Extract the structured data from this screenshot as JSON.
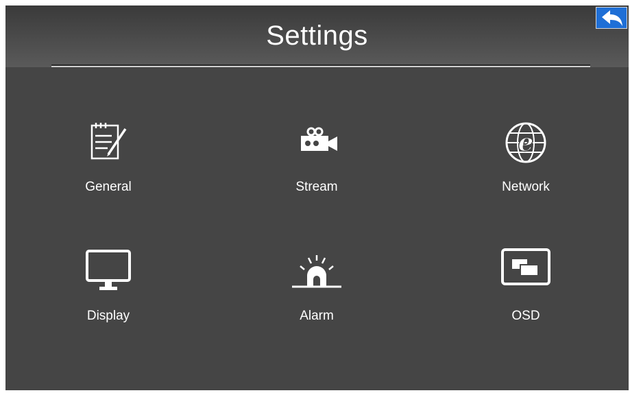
{
  "header": {
    "title": "Settings"
  },
  "back_button": {
    "icon": "back-arrow-icon",
    "color": "#1f6fd6"
  },
  "menu": [
    {
      "label": "General",
      "icon": "notepad-pencil-icon"
    },
    {
      "label": "Stream",
      "icon": "video-camera-icon"
    },
    {
      "label": "Network",
      "icon": "globe-e-icon"
    },
    {
      "label": "Display",
      "icon": "monitor-icon"
    },
    {
      "label": "Alarm",
      "icon": "alarm-siren-icon"
    },
    {
      "label": "OSD",
      "icon": "osd-overlay-icon"
    }
  ],
  "colors": {
    "background": "#454545",
    "text": "#ffffff"
  }
}
